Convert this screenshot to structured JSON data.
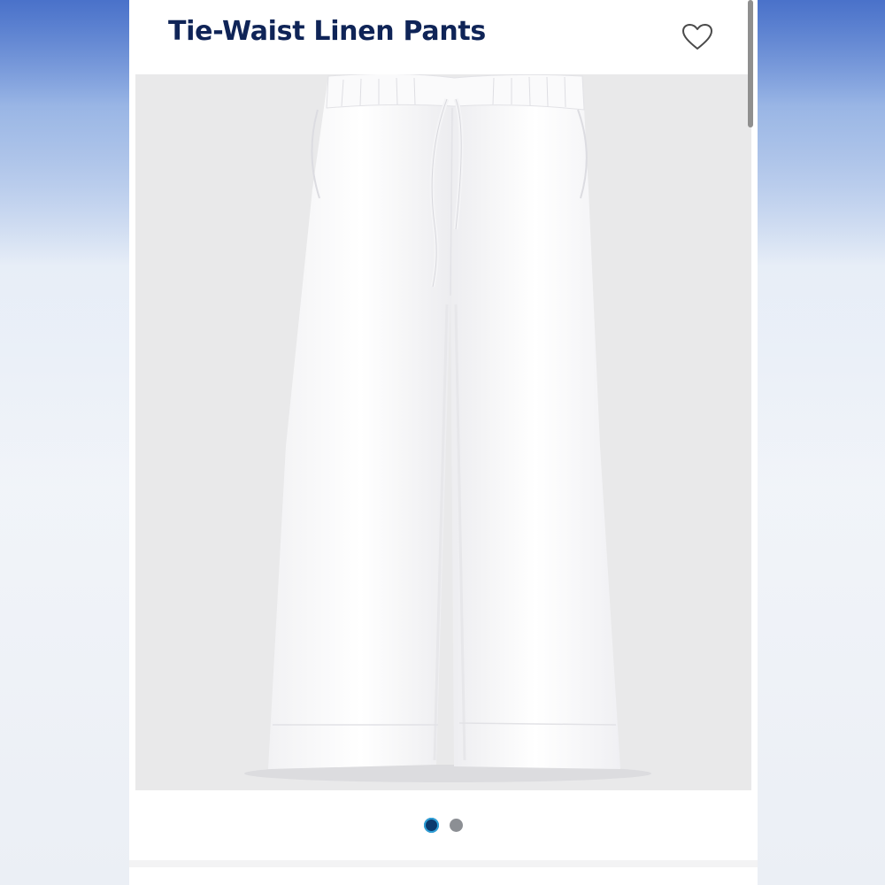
{
  "product": {
    "title": "Tie-Waist Linen Pants",
    "image_alt": "White tie-waist linen pants"
  },
  "wishlist": {
    "icon": "heart-outline-icon"
  },
  "carousel": {
    "total_images": 2,
    "active_index": 0,
    "colors": {
      "active": "#0b3a6e",
      "active_ring": "#2ea0d8",
      "inactive": "#8c8f94"
    }
  },
  "theme": {
    "title_color": "#0f2457",
    "image_background": "#e9e9ea"
  }
}
